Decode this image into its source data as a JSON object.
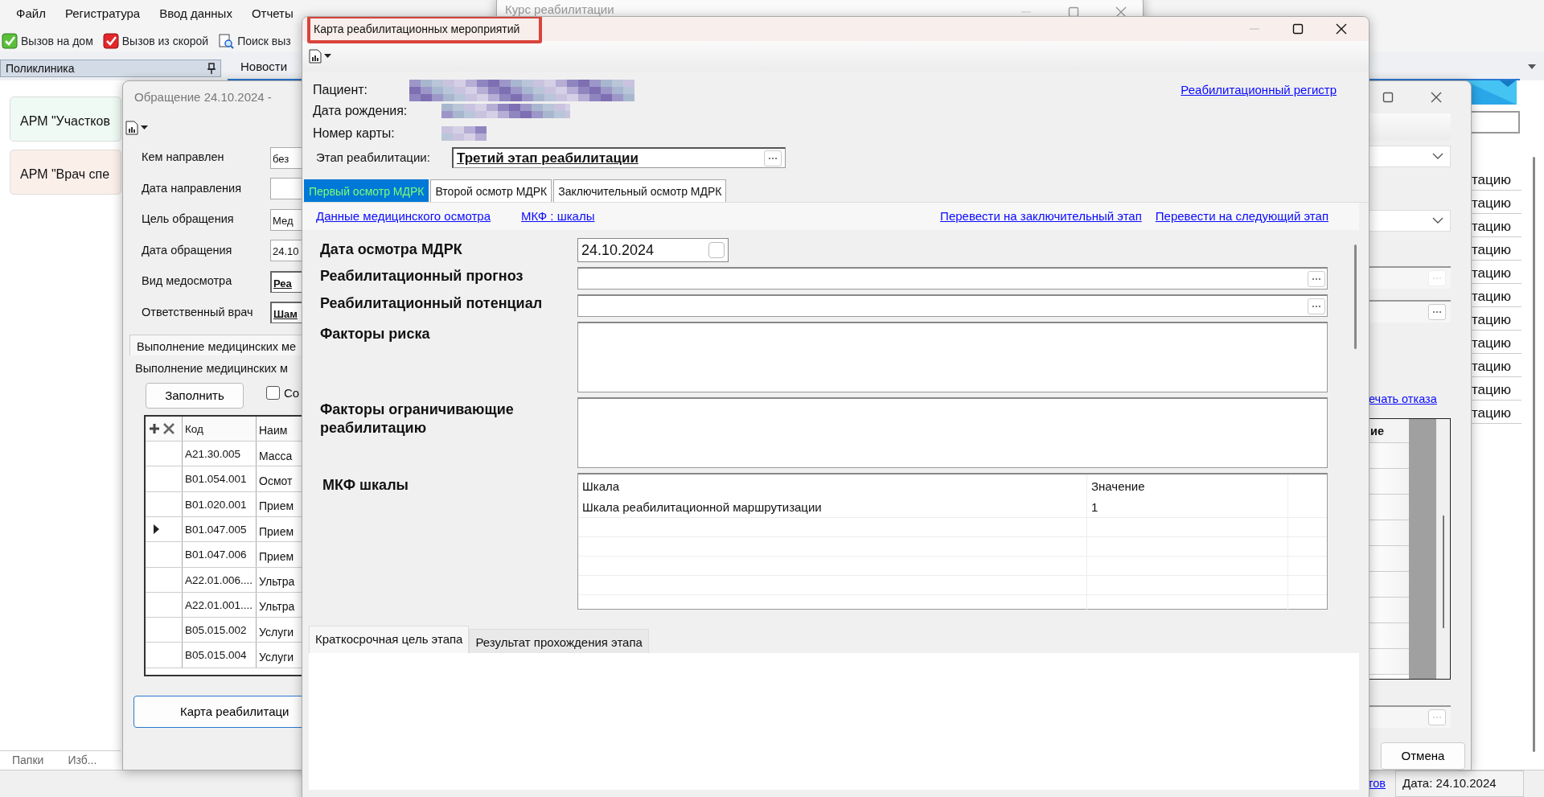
{
  "app": {
    "menu": [
      "Файл",
      "Регистратура",
      "Ввод данных",
      "Отчеты"
    ],
    "toolbar": [
      {
        "label": "Вызов на дом",
        "kind": "home"
      },
      {
        "label": "Вызов из скорой",
        "kind": "ambulance"
      },
      {
        "label": "Поиск выз",
        "kind": "search"
      }
    ],
    "left_panel": {
      "title": "Поликлиника",
      "cards": [
        {
          "label": "АРМ \"Участков",
          "color": "#effaf4"
        },
        {
          "label": "АРМ \"Врач спе",
          "color": "#fbefea"
        }
      ],
      "bottom_tabs": [
        "Папки",
        "Изб..."
      ]
    },
    "doc_tabs": [
      {
        "label": "Новости",
        "selected": true
      }
    ],
    "right_cells": [
      "тацию",
      "тацию",
      "тацию",
      "тацию",
      "тацию",
      "тацию",
      "тацию",
      "тацию",
      "тацию",
      "тацию",
      "тацию"
    ],
    "status_bar": {
      "link": "тов",
      "date": "Дата: 24.10.2024"
    }
  },
  "course_window": {
    "title": "Курс реабилитации"
  },
  "referral_window": {
    "title": "Обращение 24.10.2024 -",
    "fields": [
      {
        "label": "Кем направлен",
        "value": "без",
        "kind": "text"
      },
      {
        "label": "Дата направления",
        "kind": "text"
      },
      {
        "label": "Цель обращения",
        "value": "Мед",
        "kind": "text"
      },
      {
        "label": "Дата обращения",
        "value": "24.10",
        "kind": "text"
      },
      {
        "label": "Вид медосмотра",
        "value": "Реа",
        "kind": "bold"
      },
      {
        "label": "Ответственный врач",
        "value": "Шам",
        "kind": "bold"
      }
    ],
    "group_tab": "Выполнение медицинских ме",
    "group_title": "Выполнение медицинских м",
    "fill_button": "Заполнить",
    "checkbox": {
      "label": "Со",
      "checked": false
    },
    "table": {
      "columns": [
        "Код",
        "Наим"
      ],
      "rows": [
        {
          "code": "A21.30.005",
          "name": "Масса",
          "current": false
        },
        {
          "code": "B01.054.001",
          "name": "Осмот",
          "current": false
        },
        {
          "code": "B01.020.001",
          "name": "Прием",
          "current": false
        },
        {
          "code": "B01.047.005",
          "name": "Прием",
          "current": true
        },
        {
          "code": "B01.047.006",
          "name": "Прием",
          "current": false
        },
        {
          "code": "A22.01.006....",
          "name": "Ультра",
          "current": false
        },
        {
          "code": "A22.01.001....",
          "name": "Ультра",
          "current": false
        },
        {
          "code": "B05.015.002",
          "name": "Услуги",
          "current": false
        },
        {
          "code": "B05.015.004",
          "name": "Услуги",
          "current": false
        }
      ]
    },
    "card_button": "Карта реабилитаци",
    "print_link": "ечать отказа",
    "right_table_header": "ие",
    "cancel_button": "Отмена"
  },
  "rehab_window": {
    "title": "Карта реабилитационных мероприятий",
    "highlighted": true,
    "patient_labels": [
      "Пациент:",
      "Дата рождения:",
      "Номер карты:"
    ],
    "registry_link": "Реабилитационный регистр",
    "stage": {
      "label": "Этап реабилитации:",
      "value": "Третий этап реабилитации"
    },
    "tabs": [
      {
        "label": "Первый осмотр МДРК",
        "selected": true
      },
      {
        "label": "Второй осмотр МДРК",
        "selected": false
      },
      {
        "label": "Заключительный осмотр МДРК",
        "selected": false
      }
    ],
    "links_left": [
      "Данные медицинского осмотра",
      "МКФ : шкалы"
    ],
    "links_right": [
      "Перевести на заключительный этап",
      "Перевести на следующий этап"
    ],
    "form": [
      {
        "kind": "date",
        "label": "Дата осмотра МДРК",
        "value": "24.10.2024"
      },
      {
        "kind": "lookup",
        "label": "Реабилитационный прогноз"
      },
      {
        "kind": "lookup",
        "label": "Реабилитационный потенциал"
      },
      {
        "kind": "memo",
        "label": "Факторы риска"
      },
      {
        "kind": "memo",
        "label": "Факторы ограничивающие реабилитацию"
      },
      {
        "kind": "grid",
        "label": "МКФ шкалы",
        "columns": [
          "Шкала",
          "Значение"
        ],
        "rows": [
          [
            "Шкала реабилитационной маршрутизации",
            "1"
          ]
        ]
      }
    ],
    "bottom_tabs": [
      {
        "label": "Краткосрочная цель этапа",
        "selected": true
      },
      {
        "label": "Результат прохождения этапа",
        "selected": false
      }
    ]
  }
}
